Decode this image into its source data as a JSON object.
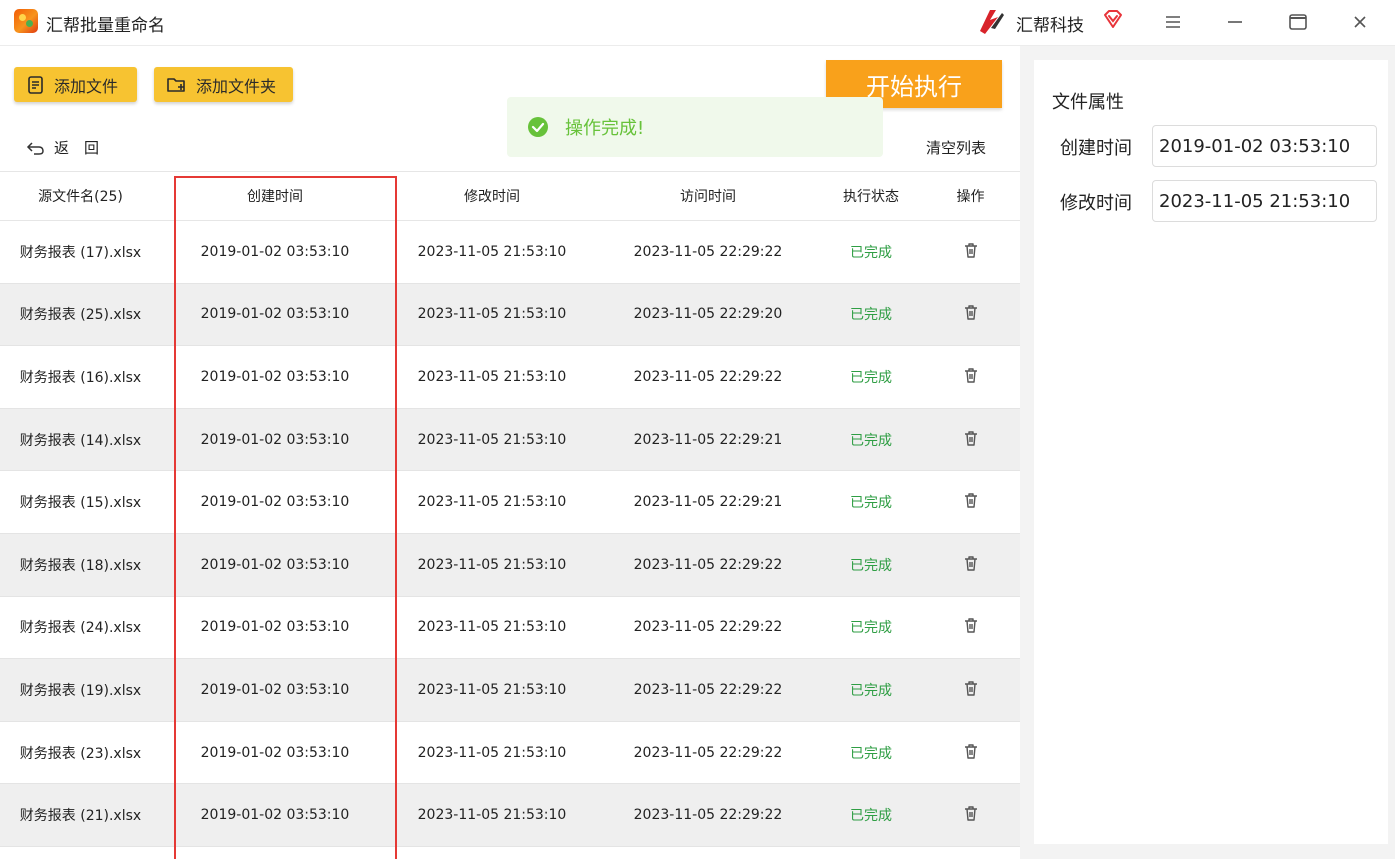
{
  "app": {
    "title": "汇帮批量重命名",
    "brand_name": "汇帮科技"
  },
  "toolbar": {
    "add_file_label": "添加文件",
    "add_folder_label": "添加文件夹",
    "start_label": "开始执行",
    "back_label": "返　回",
    "clear_label": "清空列表"
  },
  "toast": {
    "message": "操作完成!"
  },
  "table": {
    "headers": {
      "name": "源文件名(25)",
      "ctime": "创建时间",
      "mtime": "修改时间",
      "atime": "访问时间",
      "status": "执行状态",
      "op": "操作"
    },
    "rows": [
      {
        "name": "财务报表 (17).xlsx",
        "ctime": "2019-01-02 03:53:10",
        "mtime": "2023-11-05 21:53:10",
        "atime": "2023-11-05 22:29:22",
        "status": "已完成"
      },
      {
        "name": "财务报表 (25).xlsx",
        "ctime": "2019-01-02 03:53:10",
        "mtime": "2023-11-05 21:53:10",
        "atime": "2023-11-05 22:29:20",
        "status": "已完成"
      },
      {
        "name": "财务报表 (16).xlsx",
        "ctime": "2019-01-02 03:53:10",
        "mtime": "2023-11-05 21:53:10",
        "atime": "2023-11-05 22:29:22",
        "status": "已完成"
      },
      {
        "name": "财务报表 (14).xlsx",
        "ctime": "2019-01-02 03:53:10",
        "mtime": "2023-11-05 21:53:10",
        "atime": "2023-11-05 22:29:21",
        "status": "已完成"
      },
      {
        "name": "财务报表 (15).xlsx",
        "ctime": "2019-01-02 03:53:10",
        "mtime": "2023-11-05 21:53:10",
        "atime": "2023-11-05 22:29:21",
        "status": "已完成"
      },
      {
        "name": "财务报表 (18).xlsx",
        "ctime": "2019-01-02 03:53:10",
        "mtime": "2023-11-05 21:53:10",
        "atime": "2023-11-05 22:29:22",
        "status": "已完成"
      },
      {
        "name": "财务报表 (24).xlsx",
        "ctime": "2019-01-02 03:53:10",
        "mtime": "2023-11-05 21:53:10",
        "atime": "2023-11-05 22:29:22",
        "status": "已完成"
      },
      {
        "name": "财务报表 (19).xlsx",
        "ctime": "2019-01-02 03:53:10",
        "mtime": "2023-11-05 21:53:10",
        "atime": "2023-11-05 22:29:22",
        "status": "已完成"
      },
      {
        "name": "财务报表 (23).xlsx",
        "ctime": "2019-01-02 03:53:10",
        "mtime": "2023-11-05 21:53:10",
        "atime": "2023-11-05 22:29:22",
        "status": "已完成"
      },
      {
        "name": "财务报表 (21).xlsx",
        "ctime": "2019-01-02 03:53:10",
        "mtime": "2023-11-05 21:53:10",
        "atime": "2023-11-05 22:29:22",
        "status": "已完成"
      }
    ]
  },
  "properties": {
    "title": "文件属性",
    "ctime_label": "创建时间",
    "ctime_value": "2019-01-02 03:53:10",
    "mtime_label": "修改时间",
    "mtime_value": "2023-11-05 21:53:10"
  },
  "colors": {
    "accent_yellow": "#f7c331",
    "accent_orange": "#f9a11b",
    "success_green": "#2f9e44",
    "highlight_red": "#e53935"
  },
  "icons": {
    "app_logo": "app-logo-icon",
    "brand_logo": "brand-logo-icon",
    "vip": "vip-diamond-icon",
    "menu": "menu-icon",
    "minimize": "minimize-icon",
    "maximize": "maximize-icon",
    "close": "close-icon",
    "add_file": "add-file-icon",
    "add_folder": "add-folder-icon",
    "back": "back-arrow-icon",
    "success": "check-circle-icon",
    "delete": "trash-icon"
  }
}
